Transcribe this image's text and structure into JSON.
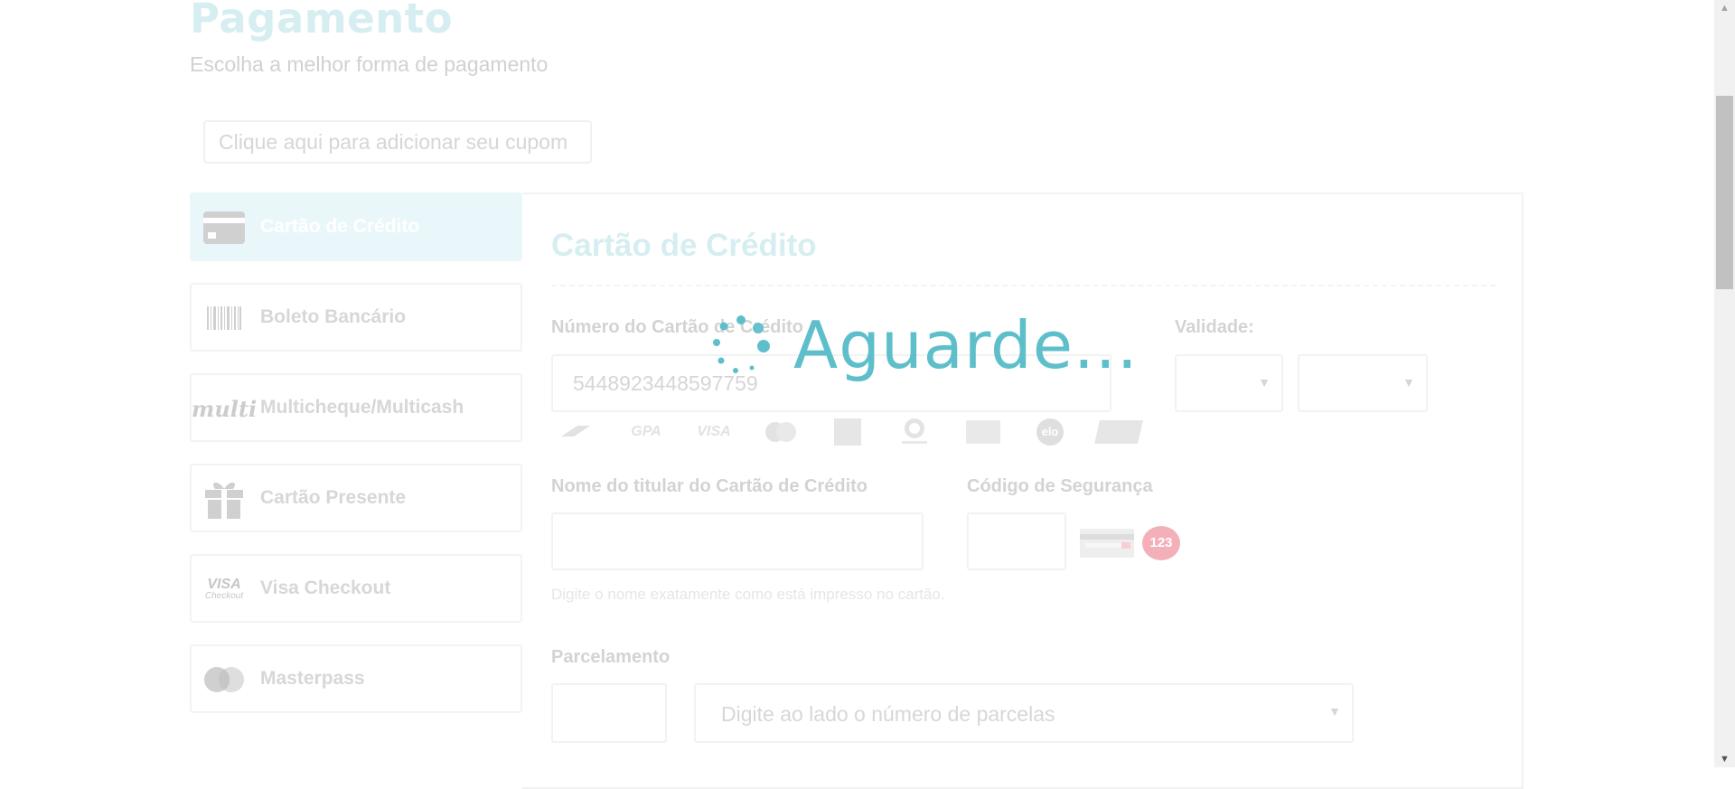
{
  "header": {
    "title": "Pagamento",
    "subtitle": "Escolha a melhor forma de pagamento"
  },
  "coupon": {
    "label": "Clique aqui para adicionar seu cupom"
  },
  "methods": [
    {
      "label": "Cartão de Crédito",
      "icon": "credit-card-icon",
      "active": true
    },
    {
      "label": "Boleto Bancário",
      "icon": "barcode-icon"
    },
    {
      "label": "Multicheque/Multicash",
      "icon": "multi-logo-icon"
    },
    {
      "label": "Cartão Presente",
      "icon": "gift-icon"
    },
    {
      "label": "Visa Checkout",
      "icon": "visa-checkout-icon"
    },
    {
      "label": "Masterpass",
      "icon": "masterpass-icon"
    }
  ],
  "panel": {
    "title": "Cartão de Crédito",
    "card_number_label": "Número do Cartão de Crédito",
    "card_number_value": "5448923448597759",
    "validity_label": "Validade:",
    "holder_label": "Nome do titular do Cartão de Crédito",
    "holder_hint": "Digite o nome exatamente como está impresso no cartão.",
    "security_label": "Código de Segurança",
    "security_badge": "123",
    "installments_label": "Parcelamento",
    "installments_select_text": "Digite ao lado o número de parcelas"
  },
  "brands": {
    "gpa": "GPA",
    "visa": "VISA",
    "elo": "elo"
  },
  "visa_checkout_logo": {
    "visa": "VISA",
    "checkout": "Checkout"
  },
  "multi_logo": "multi",
  "overlay": {
    "text": "Aguarde..."
  },
  "colors": {
    "accent": "#5ebfcb",
    "active_bg": "#e7f6f9",
    "badge": "#f2a3ad"
  }
}
